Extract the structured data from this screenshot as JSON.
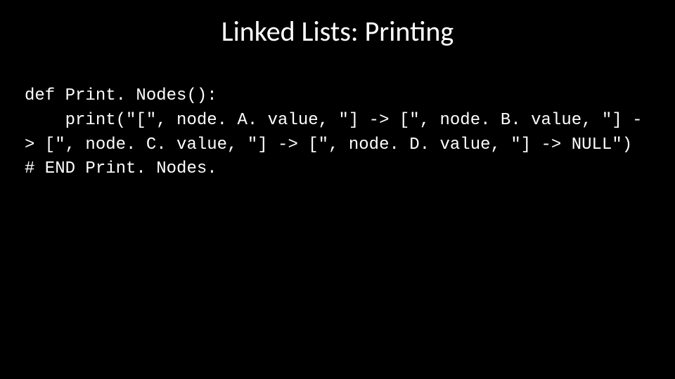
{
  "slide": {
    "title": "Linked Lists: Printing",
    "code": "def Print. Nodes():\n    print(\"[\", node. A. value, \"] -> [\", node. B. value, \"] -> [\", node. C. value, \"] -> [\", node. D. value, \"] -> NULL\")\n# END Print. Nodes."
  }
}
